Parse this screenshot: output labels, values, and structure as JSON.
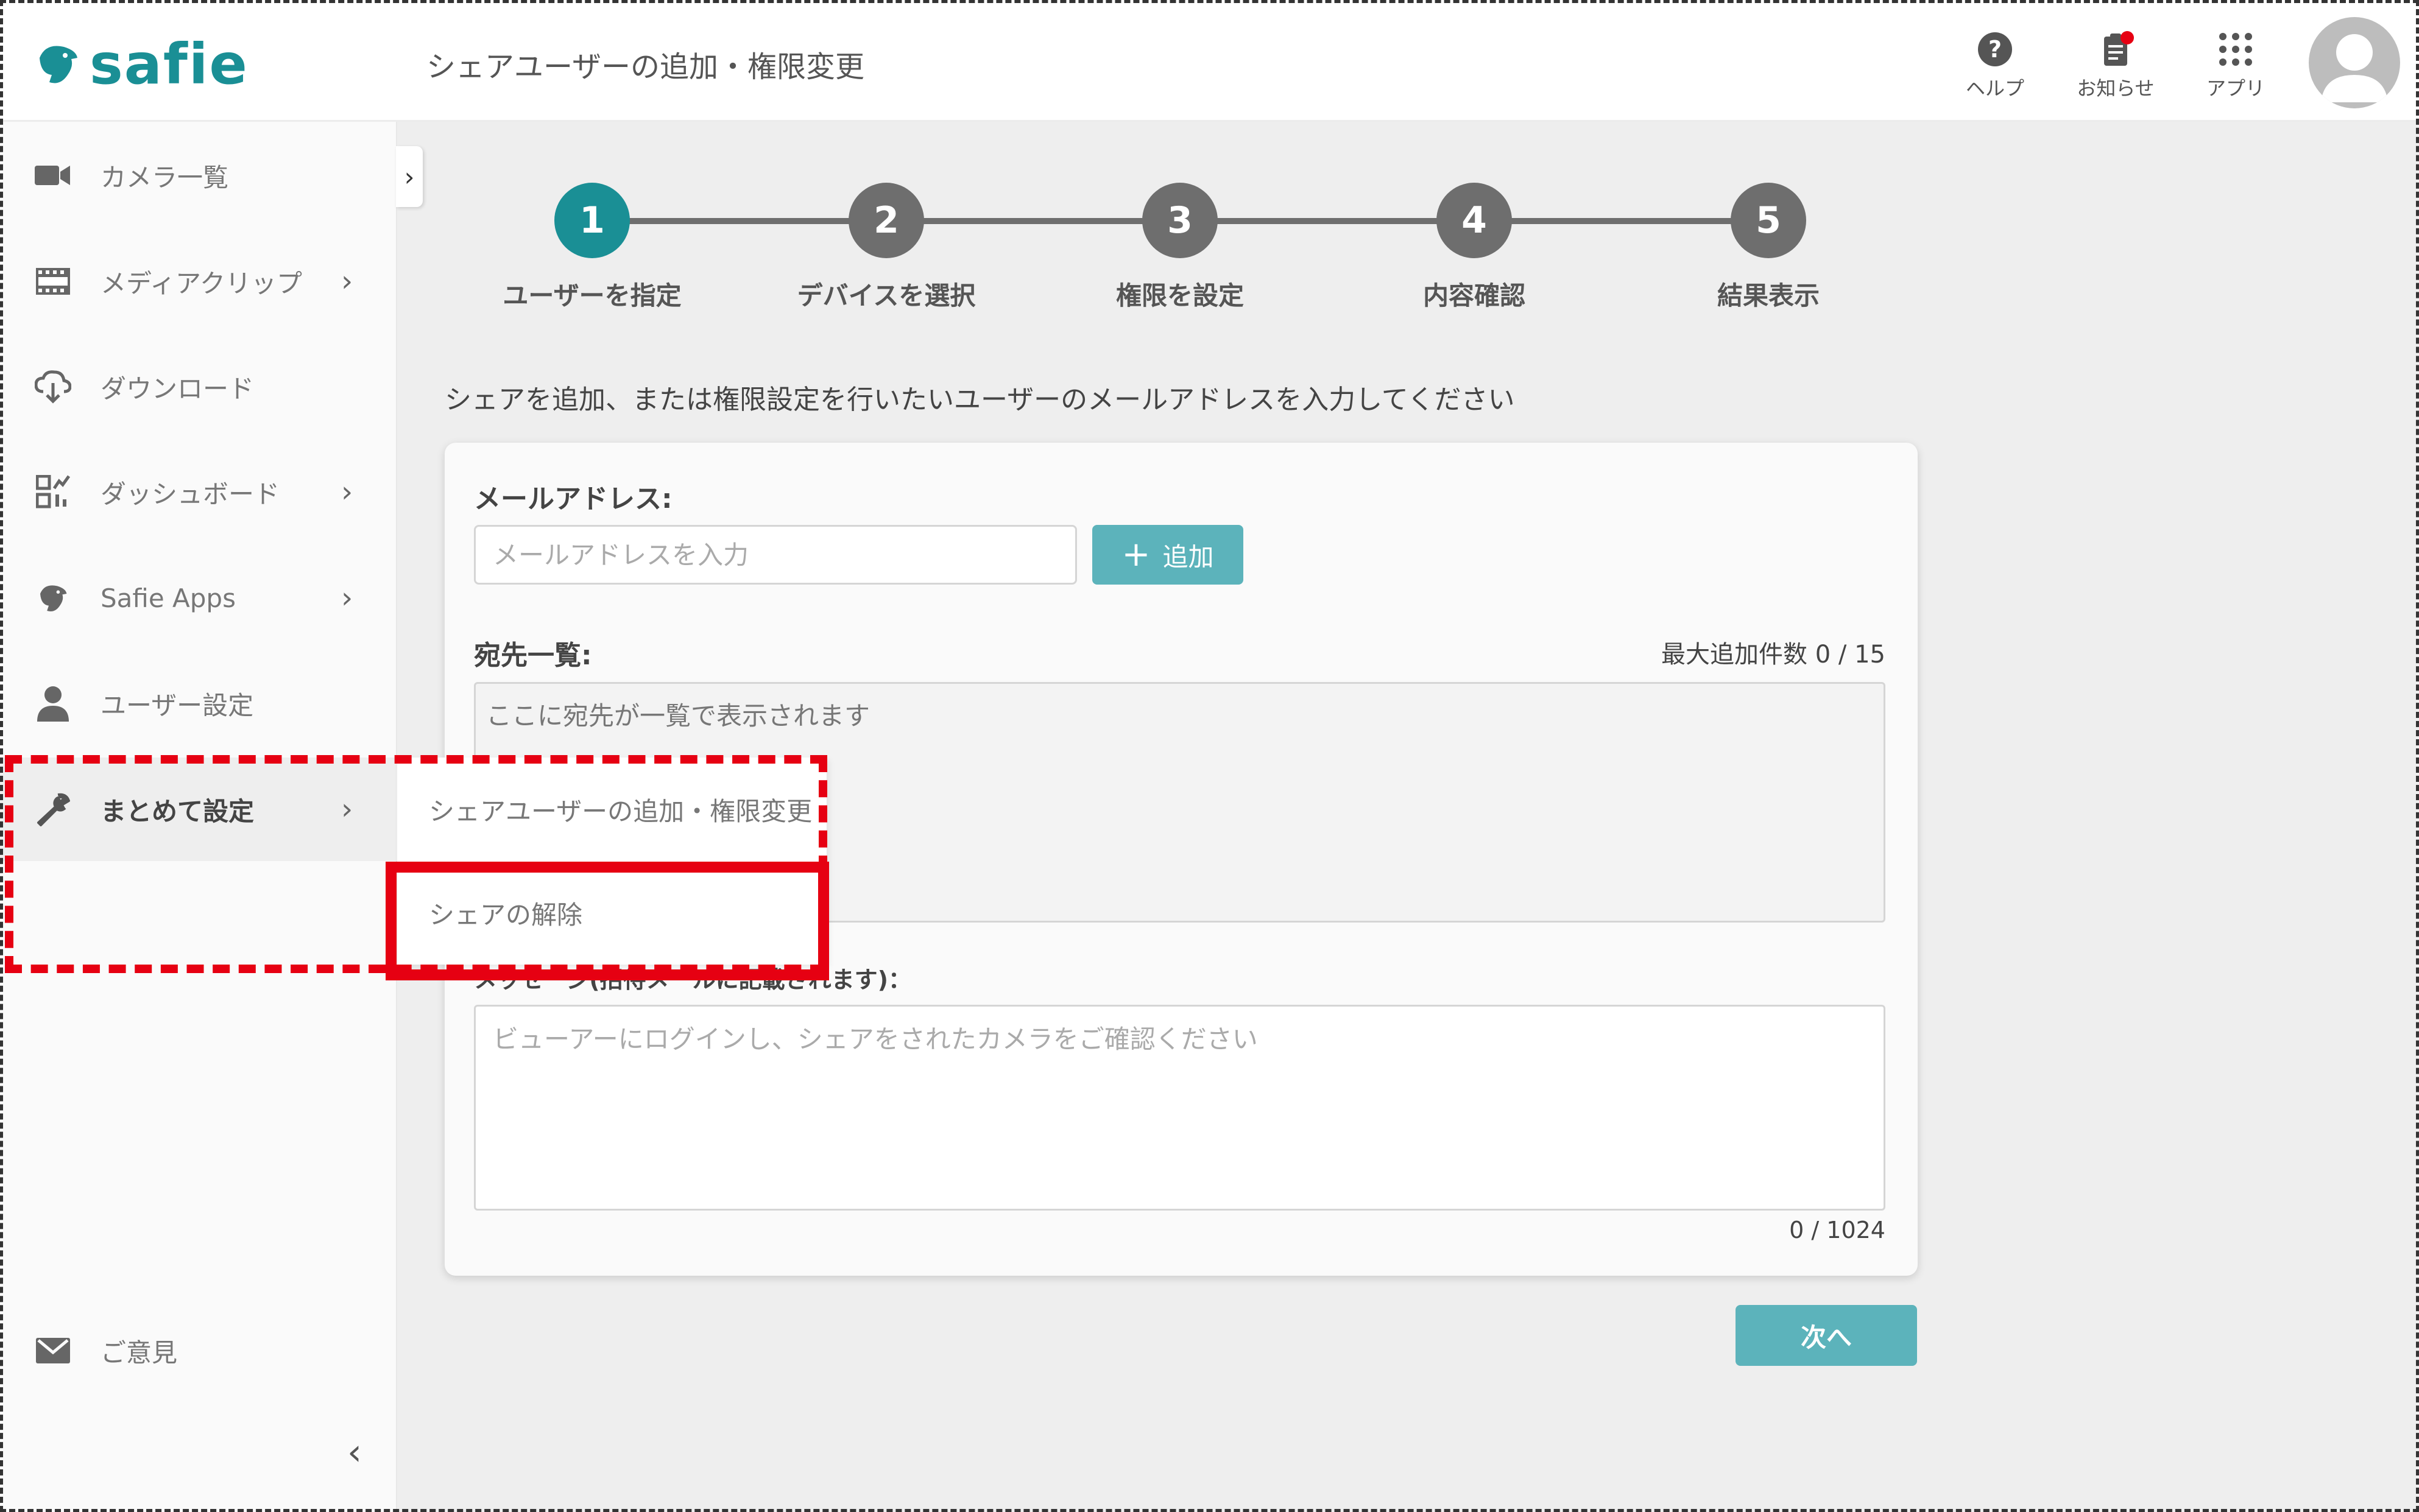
{
  "header": {
    "logo_text": "safie",
    "page_title": "シェアユーザーの追加・権限変更",
    "help_label": "ヘルプ",
    "notice_label": "お知らせ",
    "apps_label": "アプリ"
  },
  "sidebar": {
    "items": [
      {
        "label": "カメラ一覧",
        "icon": "camera-icon"
      },
      {
        "label": "メディアクリップ",
        "icon": "film-icon"
      },
      {
        "label": "ダウンロード",
        "icon": "cloud-download-icon"
      },
      {
        "label": "ダッシュボード",
        "icon": "dashboard-icon"
      },
      {
        "label": "Safie Apps",
        "icon": "safie-bird-icon"
      },
      {
        "label": "ユーザー設定",
        "icon": "person-icon"
      },
      {
        "label": "まとめて設定",
        "icon": "wrench-icon"
      }
    ],
    "feedback_label": "ご意見"
  },
  "submenu": {
    "items": [
      "シェアユーザーの追加・権限変更",
      "シェアの解除"
    ]
  },
  "stepper": {
    "steps": [
      {
        "num": "1",
        "label": "ユーザーを指定"
      },
      {
        "num": "2",
        "label": "デバイスを選択"
      },
      {
        "num": "3",
        "label": "権限を設定"
      },
      {
        "num": "4",
        "label": "内容確認"
      },
      {
        "num": "5",
        "label": "結果表示"
      }
    ],
    "active_step": 1
  },
  "form": {
    "instruction": "シェアを追加、または権限設定を行いたいユーザーのメールアドレスを入力してください",
    "email_label": "メールアドレス:",
    "email_placeholder": "メールアドレスを入力",
    "email_value": "",
    "add_button": "追加",
    "dest_label": "宛先一覧:",
    "max_count": "最大追加件数 0 / 15",
    "dest_placeholder": "ここに宛先が一覧で表示されます",
    "msg_label": "メッセージ(招待メールに記載されます)：",
    "msg_placeholder": "ビューアーにログインし、シェアをされたカメラをご確認ください",
    "char_count": "0 / 1024",
    "next_button": "次へ"
  },
  "colors": {
    "brand": "#1a8f95",
    "button": "#5cb3bb",
    "step_inactive": "#6e6e6e",
    "annotation": "#e60012",
    "notification_dot": "#e60012"
  }
}
